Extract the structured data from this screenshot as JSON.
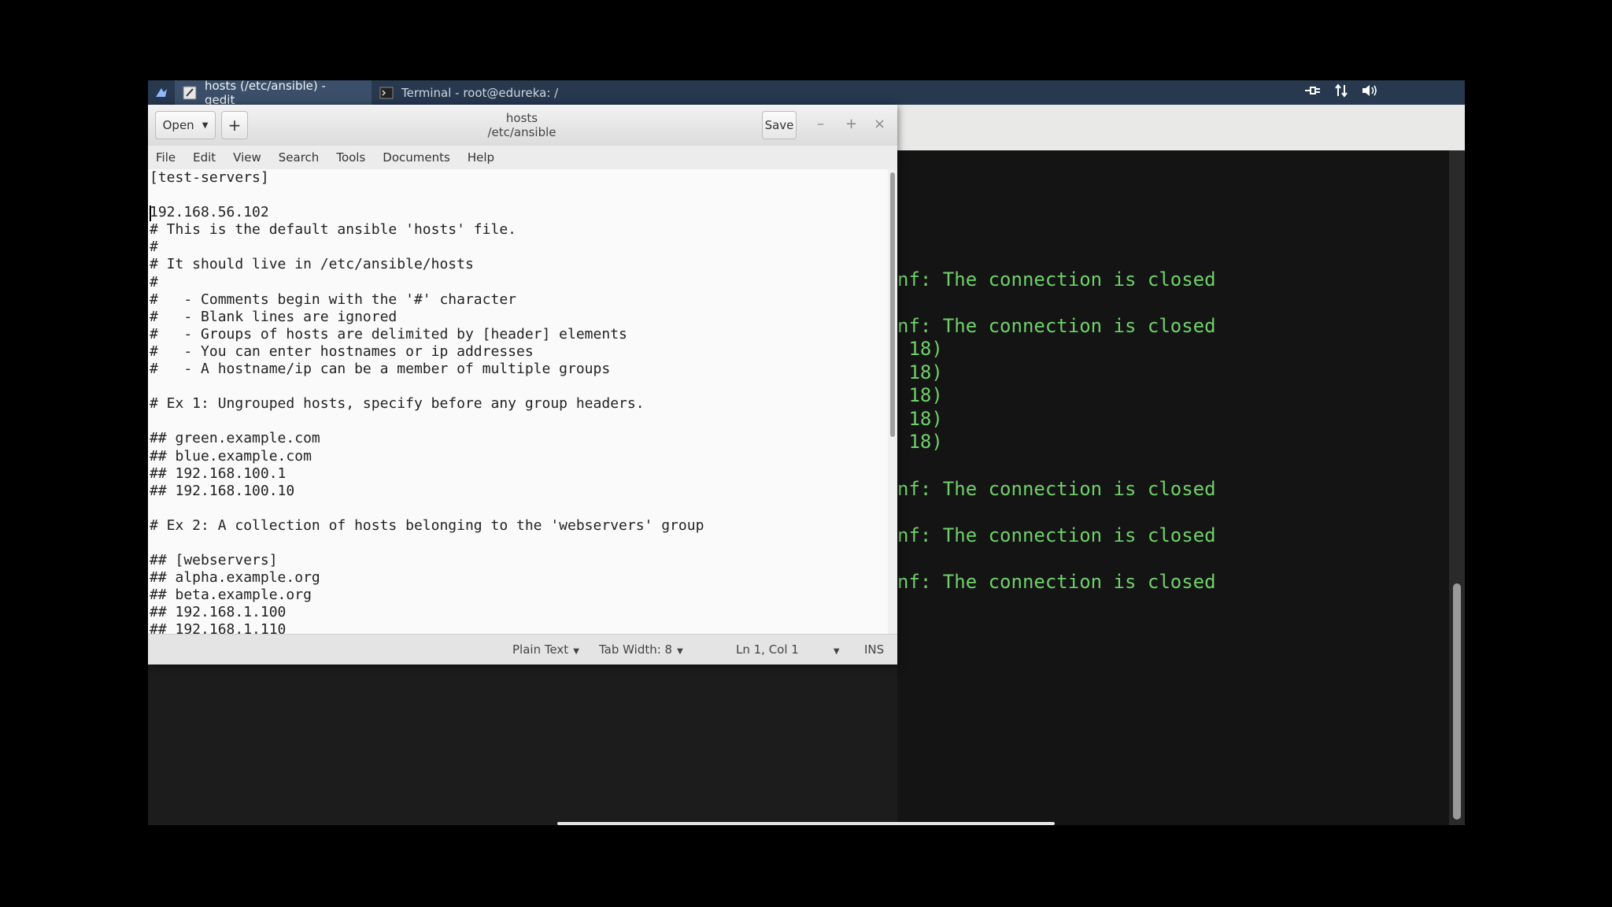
{
  "taskbar": {
    "start_icon": "menu-logo-icon",
    "tasks": [
      {
        "label": "hosts (/etc/ansible) - gedit",
        "icon": "text-editor-icon",
        "active": true
      },
      {
        "label": "Terminal - root@edureka: /",
        "icon": "terminal-icon",
        "active": false
      }
    ],
    "tray_icons": [
      "network-plug-icon",
      "transfer-arrows-icon",
      "volume-icon"
    ]
  },
  "gedit": {
    "open_label": "Open",
    "new_tab_label": "+",
    "title": "hosts",
    "subtitle": "/etc/ansible",
    "save_label": "Save",
    "window_controls": [
      "–",
      "+",
      "×"
    ],
    "menu": [
      "File",
      "Edit",
      "View",
      "Search",
      "Tools",
      "Documents",
      "Help"
    ],
    "lines": [
      "[test-servers]",
      "",
      "192.168.56.102",
      "# This is the default ansible 'hosts' file.",
      "#",
      "# It should live in /etc/ansible/hosts",
      "#",
      "#   - Comments begin with the '#' character",
      "#   - Blank lines are ignored",
      "#   - Groups of hosts are delimited by [header] elements",
      "#   - You can enter hostnames or ip addresses",
      "#   - A hostname/ip can be a member of multiple groups",
      "",
      "# Ex 1: Ungrouped hosts, specify before any group headers.",
      "",
      "## green.example.com",
      "## blue.example.com",
      "## 192.168.100.1",
      "## 192.168.100.10",
      "",
      "# Ex 2: A collection of hosts belonging to the 'webservers' group",
      "",
      "## [webservers]",
      "## alpha.example.org",
      "## beta.example.org",
      "## 192.168.1.100",
      "## 192.168.1.110"
    ],
    "status": {
      "language": "Plain Text",
      "tab_width": "Tab Width: 8",
      "position": "Ln 1, Col 1",
      "mode": "INS"
    }
  },
  "terminal": {
    "lines": [
      "nf: The connection is closed",
      "nf: The connection is closed",
      " 18)",
      " 18)",
      " 18)",
      " 18)",
      " 18)",
      "nf: The connection is closed",
      "nf: The connection is closed",
      "nf: The connection is closed"
    ],
    "text_color": "#6fd16a"
  }
}
